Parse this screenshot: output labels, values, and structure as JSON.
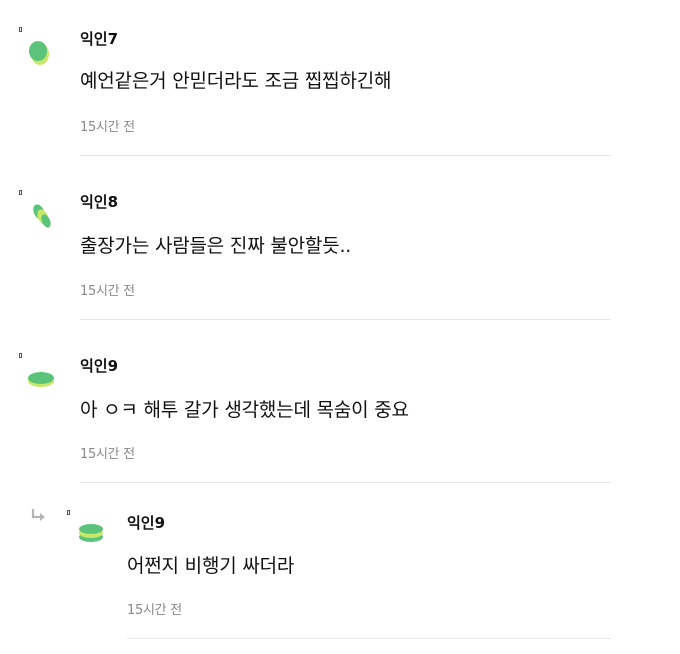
{
  "comments": [
    {
      "author": "익인7",
      "text": "예언같은거 안믿더라도 조금 찝찝하긴해",
      "time": "15시간 전",
      "avatar_icon": "green-blob-icon",
      "is_reply": false
    },
    {
      "author": "익인8",
      "text": "출장가는 사람들은 진짜 불안할듯..",
      "time": "15시간 전",
      "avatar_icon": "green-leaves-icon",
      "is_reply": false
    },
    {
      "author": "익인9",
      "text": "아 ㅇㅋ 해투 갈가 생각했는데 목숨이 중요",
      "time": "15시간 전",
      "avatar_icon": "green-disc-icon",
      "is_reply": false
    },
    {
      "author": "익인9",
      "text": "어쩐지 비행기 싸더라",
      "time": "15시간 전",
      "avatar_icon": "green-stack-icon",
      "is_reply": true
    }
  ],
  "colors": {
    "author": "#111111",
    "time": "#8a8a8a",
    "divider": "#e6e6e6",
    "avatar_green": "#5cc47a",
    "avatar_light": "#c8e86a",
    "reply_arrow": "#b5b5b5"
  }
}
